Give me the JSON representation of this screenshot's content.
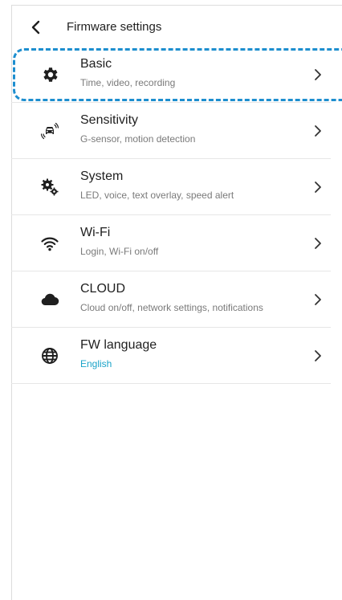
{
  "header": {
    "title": "Firmware settings",
    "back_icon": "chevron-left-icon"
  },
  "settings": {
    "items": [
      {
        "title": "Basic",
        "subtitle": "Time, video, recording",
        "icon": "gear-icon"
      },
      {
        "title": "Sensitivity",
        "subtitle": "G-sensor, motion detection",
        "icon": "car-sensor-icon"
      },
      {
        "title": "System",
        "subtitle": "LED, voice, text overlay, speed alert",
        "icon": "gears-icon"
      },
      {
        "title": "Wi-Fi",
        "subtitle": "Login, Wi-Fi on/off",
        "icon": "wifi-icon"
      },
      {
        "title": "CLOUD",
        "subtitle": "Cloud on/off, network settings, notifications",
        "icon": "cloud-icon"
      },
      {
        "title": "FW language",
        "subtitle": "English",
        "icon": "globe-icon"
      }
    ],
    "chevron_icon": "chevron-right-icon",
    "highlighted_item": "Basic"
  },
  "colors": {
    "accent": "#1aa3c8",
    "highlight_border": "#1d8ecf",
    "divider": "#e6e6e6",
    "icon": "#1f1f1f"
  }
}
